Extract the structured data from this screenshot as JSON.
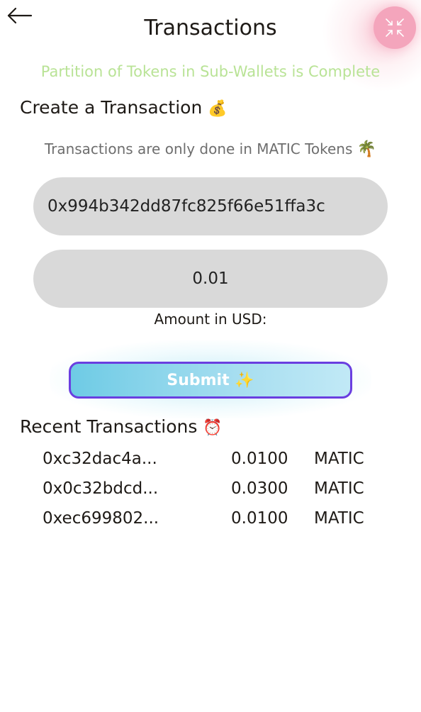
{
  "header": {
    "title": "Transactions",
    "back_icon": "arrow-left-icon",
    "fab_icon": "collapse-arrows-icon"
  },
  "status_banner": "Partition of Tokens in Sub-Wallets is Complete",
  "create_section": {
    "heading": "Create a Transaction",
    "heading_emoji": "💰",
    "note": "Transactions are only done in MATIC Tokens",
    "note_emoji": "🌴",
    "address_value": "0x994b342dd87fc825f66e51ffa3c",
    "amount_value": "0.01",
    "amount_label": "Amount in USD:",
    "submit_label": "Submit ✨"
  },
  "recent_section": {
    "heading": "Recent Transactions",
    "heading_emoji": "⏰",
    "transactions": [
      {
        "hash": "0xc32dac4a...",
        "amount": "0.0100",
        "unit": "MATIC"
      },
      {
        "hash": "0x0c32bdcd...",
        "amount": "0.0300",
        "unit": "MATIC"
      },
      {
        "hash": "0xec699802...",
        "amount": "0.0100",
        "unit": "MATIC"
      }
    ]
  },
  "colors": {
    "banner": "#b9e396",
    "fab": "#f4a5bc",
    "submit_border": "#6a3ee0",
    "submit_fill": "#6ecbe5",
    "field_bg": "#d9d9d9"
  }
}
